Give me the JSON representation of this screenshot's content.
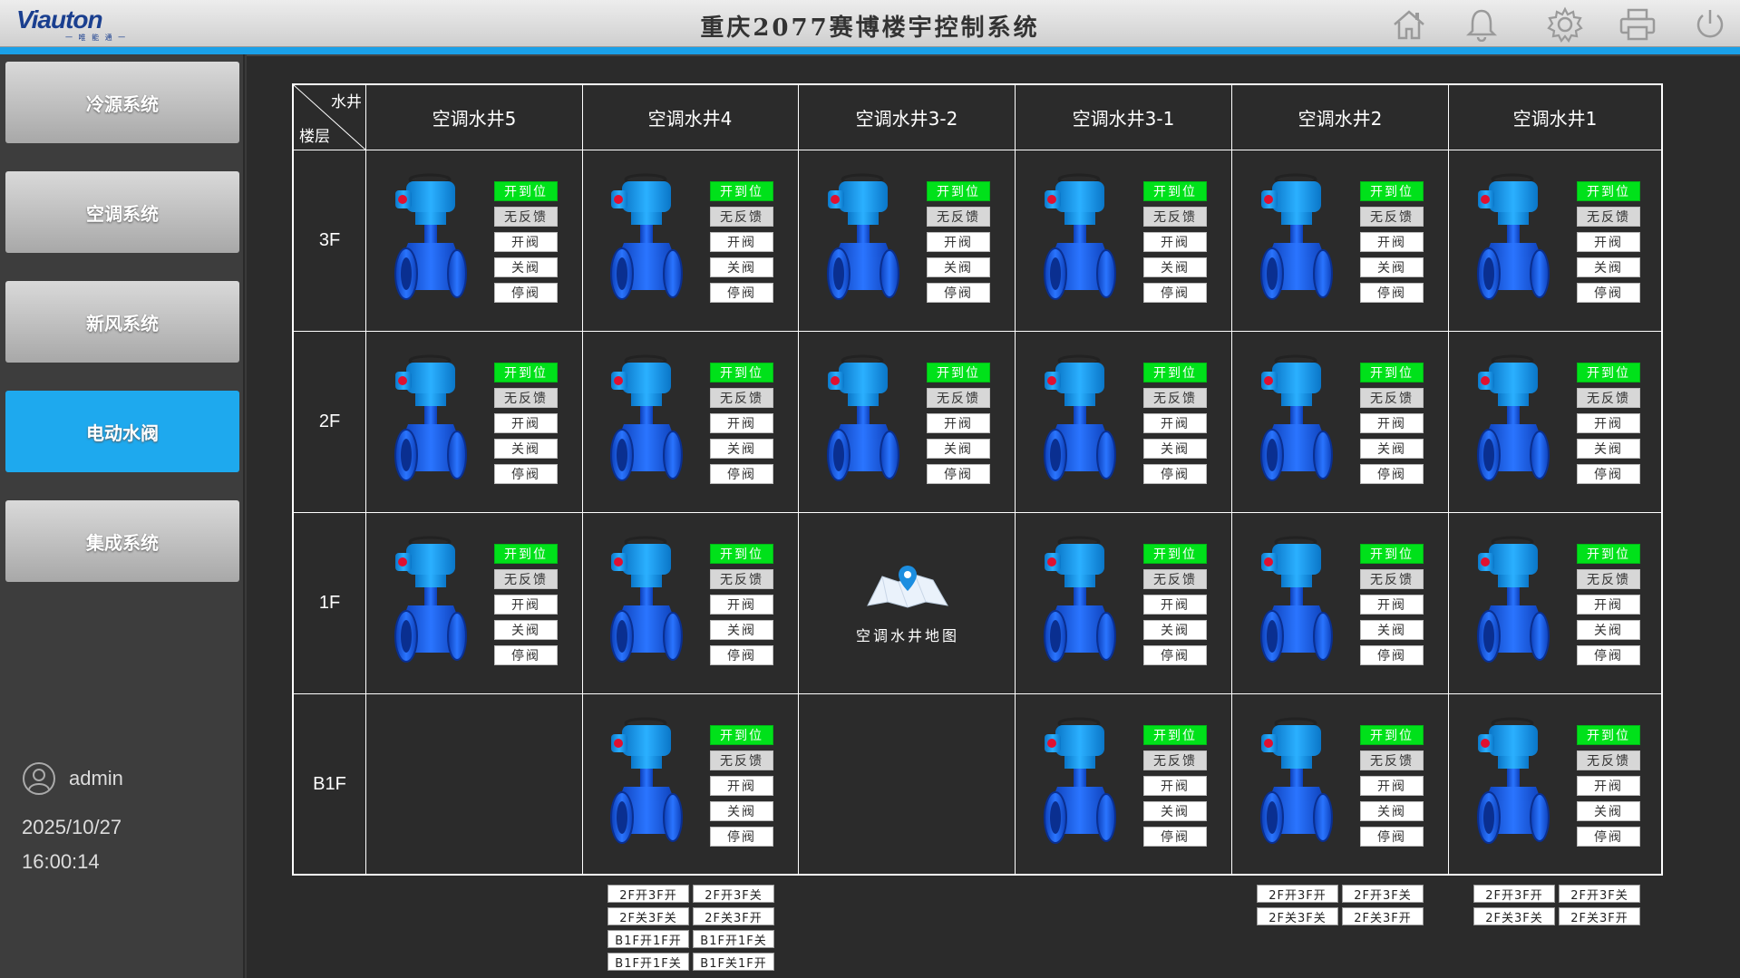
{
  "header": {
    "logo": "Viauton",
    "logo_sub": "一 唯 能 通 一",
    "title": "重庆2077赛博楼宇控制系统",
    "icons": [
      "home-icon",
      "bell-icon",
      "gear-icon",
      "printer-icon",
      "power-icon"
    ]
  },
  "sidebar": {
    "items": [
      {
        "label": "冷源系统",
        "active": false
      },
      {
        "label": "空调系统",
        "active": false
      },
      {
        "label": "新风系统",
        "active": false
      },
      {
        "label": "电动水阀",
        "active": true
      },
      {
        "label": "集成系统",
        "active": false
      }
    ],
    "user": "admin",
    "date": "2025/10/27",
    "time": "16:00:14"
  },
  "table": {
    "corner_top": "水井",
    "corner_bottom": "楼层",
    "columns": [
      "空调水井5",
      "空调水井4",
      "空调水井3-2",
      "空调水井3-1",
      "空调水井2",
      "空调水井1"
    ],
    "floors": [
      "3F",
      "2F",
      "1F",
      "B1F"
    ],
    "valve_buttons": {
      "status": "开到位",
      "feedback": "无反馈",
      "open": "开阀",
      "close": "关阀",
      "stop": "停阀"
    },
    "map_label": "空调水井地图"
  },
  "combos": {
    "col4": [
      "2F开3F开",
      "2F开3F关",
      "2F关3F关",
      "2F关3F开",
      "B1F开1F开",
      "B1F开1F关",
      "B1F开1F关",
      "B1F关1F开"
    ],
    "col2": [
      "2F开3F开",
      "2F开3F关",
      "2F关3F关",
      "2F关3F开"
    ],
    "col1": [
      "2F开3F开",
      "2F开3F关",
      "2F关3F关",
      "2F关3F开"
    ]
  },
  "colors": {
    "accent": "#1aa0e8",
    "active_nav": "#1ea9ee",
    "status_green": "#00e11a",
    "valve_blue": "#1a5fe0"
  }
}
